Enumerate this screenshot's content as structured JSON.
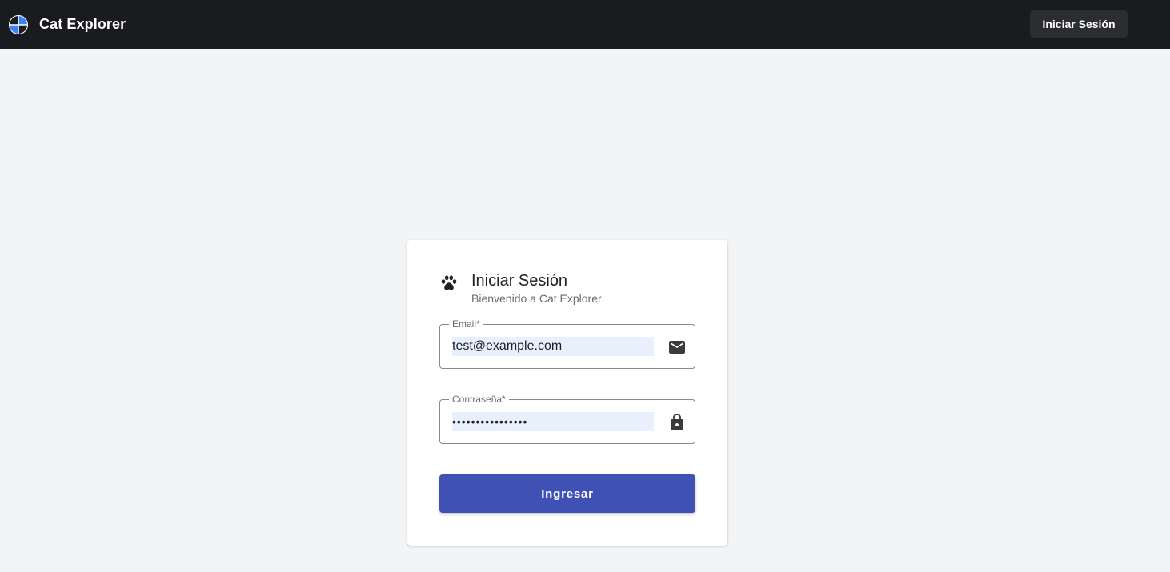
{
  "app": {
    "title": "Cat Explorer",
    "logo_icon": "globe-icon"
  },
  "header": {
    "login_label": "Iniciar Sesión"
  },
  "login": {
    "icon": "paw-icon",
    "title": "Iniciar Sesión",
    "subtitle": "Bienvenido a Cat Explorer",
    "email": {
      "label": "Email*",
      "value": "test@example.com",
      "icon": "mail-icon"
    },
    "password": {
      "label": "Contraseña*",
      "value": "••••••••••••••••",
      "icon": "lock-icon"
    },
    "submit_label": "Ingresar"
  },
  "colors": {
    "topbar": "#1a1b1e",
    "page_background": "#f3f4f6",
    "primary": "#3f51b5",
    "autofill": "#e8f0fe",
    "logo_accent": "#3b82f6"
  }
}
